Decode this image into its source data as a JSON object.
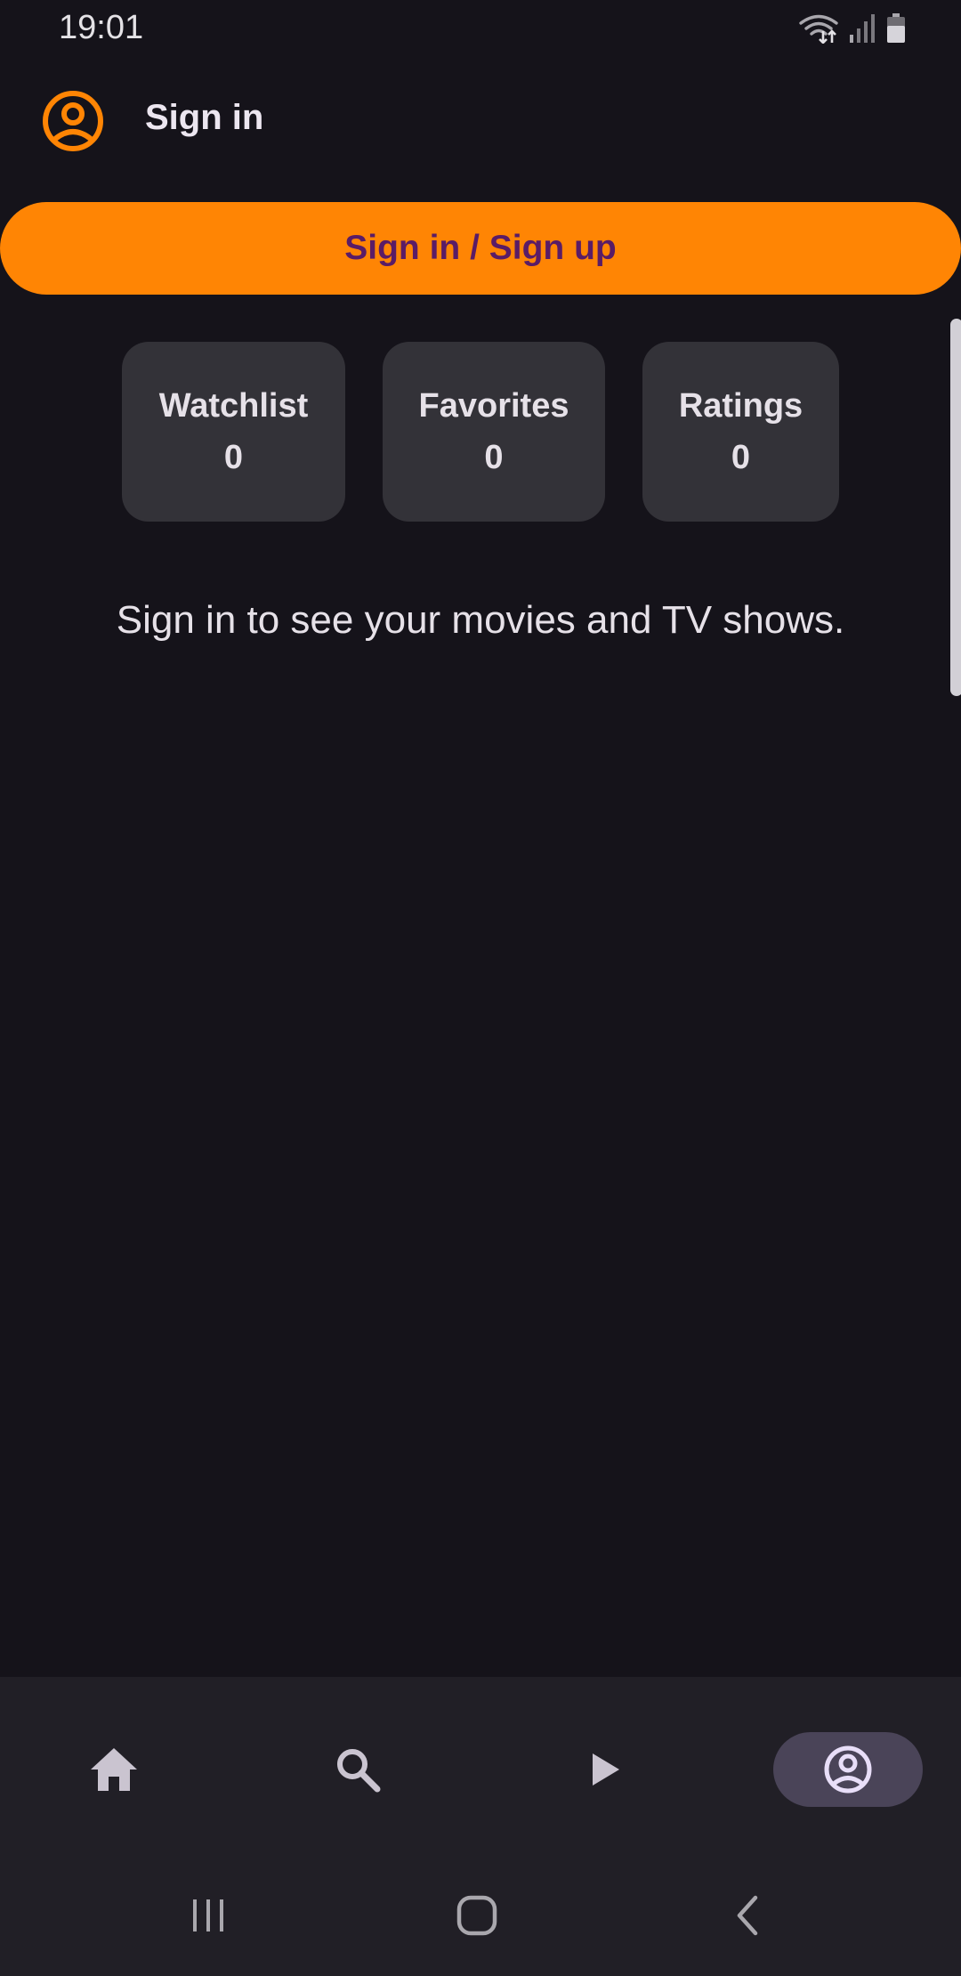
{
  "status_bar": {
    "time": "19:01",
    "icons": [
      "wifi-icon",
      "signal-icon",
      "battery-icon"
    ]
  },
  "header": {
    "title": "Sign in",
    "icon": "account-circle-icon"
  },
  "primary_action": {
    "label": "Sign in / Sign up"
  },
  "stats": [
    {
      "label": "Watchlist",
      "value": "0"
    },
    {
      "label": "Favorites",
      "value": "0"
    },
    {
      "label": "Ratings",
      "value": "0"
    }
  ],
  "message": "Sign in to see your movies and TV shows.",
  "bottom_nav": {
    "items": [
      {
        "icon": "home-icon",
        "selected": false
      },
      {
        "icon": "search-icon",
        "selected": false
      },
      {
        "icon": "play-icon",
        "selected": false
      },
      {
        "icon": "account-circle-icon",
        "selected": true
      }
    ]
  },
  "system_nav": {
    "buttons": [
      "recents-icon",
      "home-button-icon",
      "back-icon"
    ]
  },
  "colors": {
    "background": "#15131a",
    "accent": "#ff8504",
    "accent_text": "#5a1c66",
    "card": "#333238",
    "nav_background": "#211f26",
    "nav_selected": "#4a4458"
  }
}
